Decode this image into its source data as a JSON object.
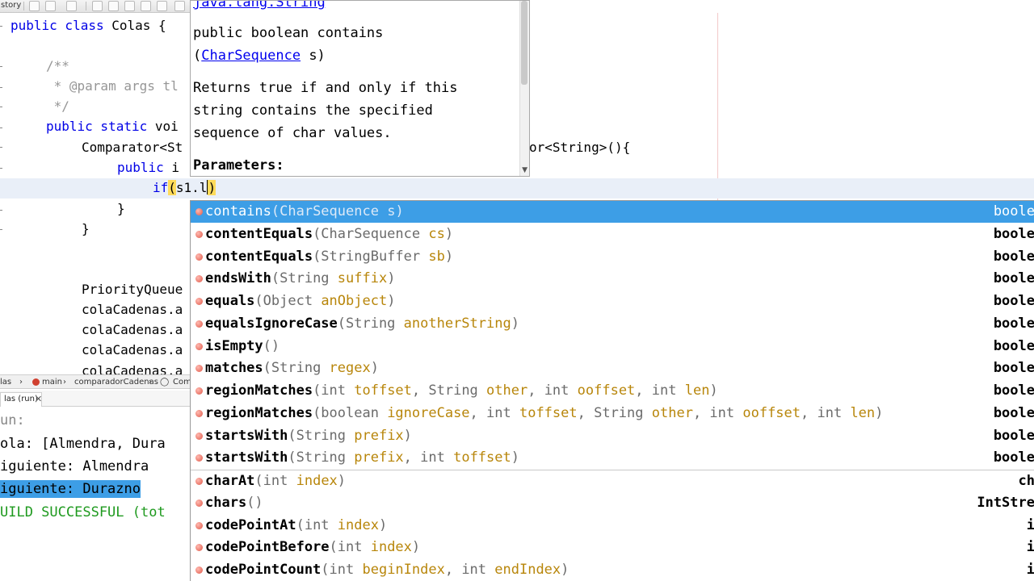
{
  "toolbar": {
    "label": "story"
  },
  "editor": {
    "lines": {
      "class_decl_kw": "public class",
      "class_decl_rest": " Colas {",
      "javadoc_open": "/**",
      "javadoc_param": " * @param args tl",
      "javadoc_close": " */",
      "main_kw": "public static",
      "main_rest": " voi",
      "comparator_decl": "Comparator<St",
      "compare_kw": "public",
      "compare_rest": " i",
      "if_kw": "if",
      "if_open": "(",
      "if_expr": "s1.l",
      "if_close": ")",
      "brace_inner": "}",
      "brace_outer": "}",
      "pq_decl": "PriorityQueue",
      "add1": "colaCadenas.a",
      "add2": "colaCadenas.a",
      "add3": "colaCadenas.a",
      "add4": "colaCadenas.a",
      "comparator_tail": "or<String>(){"
    }
  },
  "javadoc": {
    "class_link": "java.lang.String",
    "signature_prefix": "public boolean contains",
    "signature_open": "(",
    "signature_param_type": "CharSequence",
    "signature_param_rest": " s)",
    "description_1": "Returns true if and only if this",
    "description_2": "string contains the specified",
    "description_3": "sequence of char values.",
    "parameters_heading": "Parameters:"
  },
  "breadcrumb": {
    "items": [
      "las",
      "main",
      "comparadorCadenas",
      "Com"
    ]
  },
  "output": {
    "tab_label": "las (run)",
    "lines": [
      {
        "text": "un:",
        "style": "muted"
      },
      {
        "text": "ola: [Almendra, Dura",
        "style": "normal"
      },
      {
        "text": "iguiente: Almendra",
        "style": "normal"
      },
      {
        "text": "iguiente: Durazno",
        "style": "selected"
      },
      {
        "text": "UILD SUCCESSFUL (tot",
        "style": "success"
      }
    ]
  },
  "completion": {
    "items": [
      {
        "name": "contains",
        "params": "(CharSequence s)",
        "ret": "boole",
        "selected": true
      },
      {
        "name": "contentEquals",
        "params": "(CharSequence cs)",
        "ret": "boole"
      },
      {
        "name": "contentEquals",
        "params": "(StringBuffer sb)",
        "ret": "boole"
      },
      {
        "name": "endsWith",
        "params": "(String suffix)",
        "ret": "boole"
      },
      {
        "name": "equals",
        "params": "(Object anObject)",
        "ret": "boole"
      },
      {
        "name": "equalsIgnoreCase",
        "params": "(String anotherString)",
        "ret": "boole"
      },
      {
        "name": "isEmpty",
        "params": "()",
        "ret": "boole"
      },
      {
        "name": "matches",
        "params": "(String regex)",
        "ret": "boole"
      },
      {
        "name": "regionMatches",
        "params": "(int toffset, String other, int ooffset, int len)",
        "ret": "boole"
      },
      {
        "name": "regionMatches",
        "params": "(boolean ignoreCase, int toffset, String other, int ooffset, int len)",
        "ret": "boole"
      },
      {
        "name": "startsWith",
        "params": "(String prefix)",
        "ret": "boole"
      },
      {
        "name": "startsWith",
        "params": "(String prefix, int toffset)",
        "ret": "boole"
      },
      {
        "name": "charAt",
        "params": "(int index)",
        "ret": "ch",
        "divider": true
      },
      {
        "name": "chars",
        "params": "()",
        "ret": "IntStre"
      },
      {
        "name": "codePointAt",
        "params": "(int index)",
        "ret": "i"
      },
      {
        "name": "codePointBefore",
        "params": "(int index)",
        "ret": "i"
      },
      {
        "name": "codePointCount",
        "params": "(int beginIndex, int endIndex)",
        "ret": "i"
      }
    ]
  }
}
